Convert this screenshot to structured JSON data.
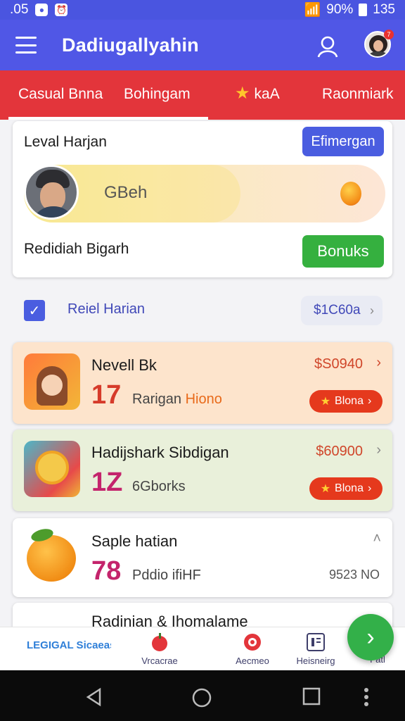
{
  "status_bar": {
    "time_left": ".05",
    "battery": "90%",
    "clock": "135"
  },
  "app_bar": {
    "title": "Dadiugallyahin",
    "notification_count": "7"
  },
  "tabs": [
    {
      "label": "Casual Bnna"
    },
    {
      "label": "Bohingam"
    },
    {
      "label": "kaA"
    },
    {
      "label": "Raonmiark"
    }
  ],
  "level_card": {
    "level_label": "Leval Harjan",
    "action_button": "Efimergan",
    "progress_text": "GBeh",
    "reward_label": "Redidiah Bigarh",
    "bonus_button": "Bonuks"
  },
  "task": {
    "label": "Reiel Harian",
    "amount": "$1C60a"
  },
  "games": [
    {
      "name": "Nevell Bk",
      "value": "17",
      "sub": "Rarigan",
      "sub2": "Hiono",
      "price": "$S0940",
      "bonus": "Blona"
    },
    {
      "name": "Hadijshark Sibdigan",
      "value": "1Z",
      "sub": "6Gborks",
      "price": "$60900",
      "bonus": "Blona"
    },
    {
      "name": "Saple hatian",
      "value": "78",
      "sub": "Pddio ifiHF",
      "meta": "9523 NO"
    },
    {
      "name": "Radinian & Ihomalame"
    }
  ],
  "bottom_nav": [
    {
      "label": "Vrcacrae"
    },
    {
      "label": "Aecmeo"
    },
    {
      "label": "Heisneirg"
    },
    {
      "label": "Fatl"
    }
  ],
  "bottom_nav_logo": "LEGIGAL Sicaeas",
  "colors": {
    "primary": "#5057e6",
    "tabs": "#e3353b",
    "green": "#35b03f",
    "bonus": "#e5391d"
  }
}
